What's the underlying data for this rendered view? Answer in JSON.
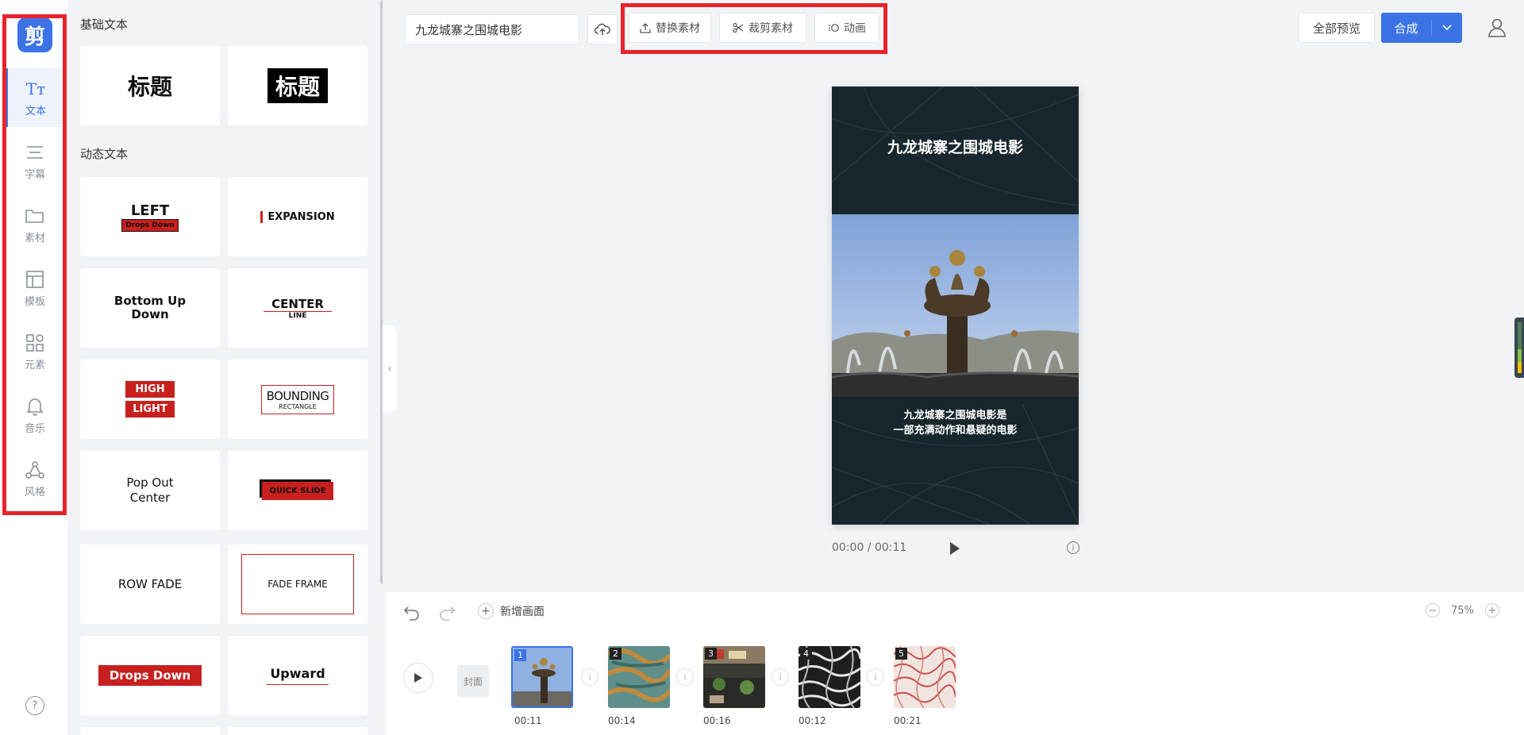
{
  "app": {
    "logo_glyph": "剪"
  },
  "nav": {
    "items": [
      {
        "label": "文本",
        "icon": "text-icon"
      },
      {
        "label": "字幕",
        "icon": "subtitle-icon"
      },
      {
        "label": "素材",
        "icon": "folder-icon"
      },
      {
        "label": "模板",
        "icon": "template-icon"
      },
      {
        "label": "元素",
        "icon": "elements-icon"
      },
      {
        "label": "音乐",
        "icon": "bell-icon"
      },
      {
        "label": "风格",
        "icon": "style-icon"
      }
    ],
    "active": "文本"
  },
  "panel": {
    "basic_title": "基础文本",
    "dynamic_title": "动态文本",
    "basic_cards": [
      {
        "text": "标题"
      },
      {
        "text": "标题"
      }
    ],
    "dynamic_cards": [
      {
        "line1": "LEFT",
        "line2": "Drops Down"
      },
      {
        "line1": "EXPANSION"
      },
      {
        "line1": "Bottom Up",
        "line2": "Down"
      },
      {
        "line1": "CENTER",
        "line2": "LINE"
      },
      {
        "line1": "HIGH",
        "line2": "LIGHT"
      },
      {
        "line1": "BOUNDING",
        "line2": "RECTANGLE"
      },
      {
        "line1": "Pop Out",
        "line2": "Center"
      },
      {
        "line1": "QUICK SLIDE"
      },
      {
        "line1": "ROW FADE"
      },
      {
        "line1": "FADE FRAME"
      },
      {
        "line1": "Drops Down"
      },
      {
        "line1": "Upward"
      }
    ]
  },
  "toolbar": {
    "project_title": "九龙城寨之围城电影",
    "replace_label": "替换素材",
    "crop_label": "裁剪素材",
    "animation_label": "动画",
    "preview_all_label": "全部预览",
    "compose_label": "合成"
  },
  "preview": {
    "title": "九龙城寨之围城电影",
    "caption_line1": "九龙城寨之围城电影是",
    "caption_line2": "一部充满动作和悬疑的电影",
    "time": "00:00 / 00:11"
  },
  "timeline": {
    "add_scene_label": "新增画面",
    "zoom": "75%",
    "cover_label": "封面",
    "clips": [
      {
        "num": "1",
        "time": "00:11",
        "selected": true
      },
      {
        "num": "2",
        "time": "00:14"
      },
      {
        "num": "3",
        "time": "00:16"
      },
      {
        "num": "4",
        "time": "00:12"
      },
      {
        "num": "5",
        "time": "00:21"
      }
    ]
  },
  "colors": {
    "accent": "#3b73e6",
    "highlight_outline": "#e8232b",
    "preview_bg": "#17272d"
  }
}
